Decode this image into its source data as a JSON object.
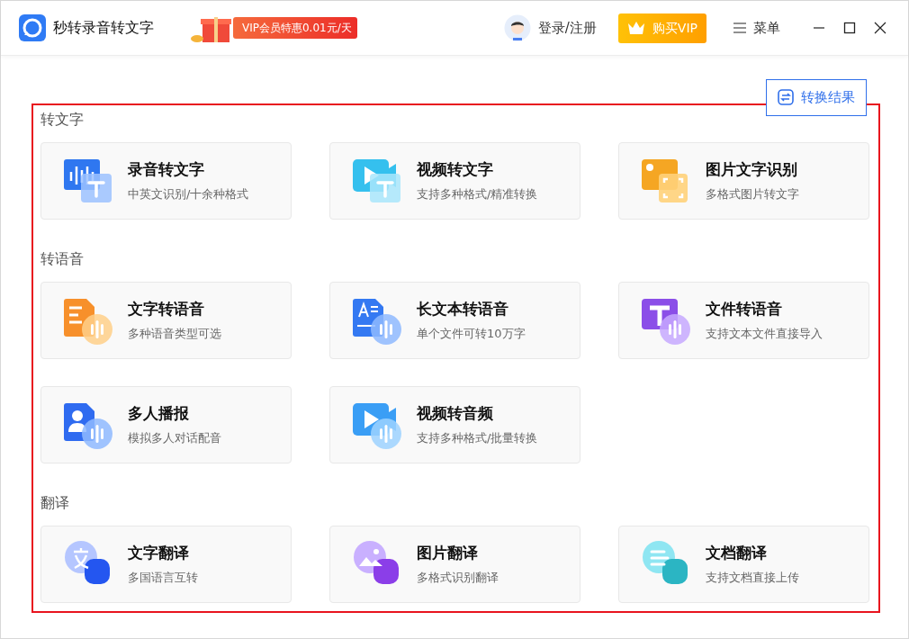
{
  "app": {
    "title": "秒转录音转文字"
  },
  "promo": {
    "text": "VIP会员特惠0.01元/天"
  },
  "header": {
    "login": "登录/注册",
    "vip_button": "购买VIP",
    "menu": "菜单"
  },
  "results_button": {
    "label": "转换结果"
  },
  "content": {
    "highlighted": true,
    "sections": [
      {
        "title": "转文字",
        "cards": [
          {
            "kind": "audio-text",
            "title": "录音转文字",
            "subtitle": "中英文识别/十余种格式"
          },
          {
            "kind": "video-text",
            "title": "视频转文字",
            "subtitle": "支持多种格式/精准转换"
          },
          {
            "kind": "image-text",
            "title": "图片文字识别",
            "subtitle": "多格式图片转文字"
          }
        ]
      },
      {
        "title": "转语音",
        "cards": [
          {
            "kind": "text-speech",
            "title": "文字转语音",
            "subtitle": "多种语音类型可选"
          },
          {
            "kind": "longtext-speech",
            "title": "长文本转语音",
            "subtitle": "单个文件可转10万字"
          },
          {
            "kind": "file-speech",
            "title": "文件转语音",
            "subtitle": "支持文本文件直接导入"
          },
          {
            "kind": "people-speech",
            "title": "多人播报",
            "subtitle": "模拟多人对话配音"
          },
          {
            "kind": "video-audio",
            "title": "视频转音频",
            "subtitle": "支持多种格式/批量转换"
          }
        ]
      },
      {
        "title": "翻译",
        "cards": [
          {
            "kind": "text-translate",
            "title": "文字翻译",
            "subtitle": "多国语言互转"
          },
          {
            "kind": "image-translate",
            "title": "图片翻译",
            "subtitle": "多格式识别翻译"
          },
          {
            "kind": "doc-translate",
            "title": "文档翻译",
            "subtitle": "支持文档直接上传"
          }
        ]
      }
    ]
  }
}
